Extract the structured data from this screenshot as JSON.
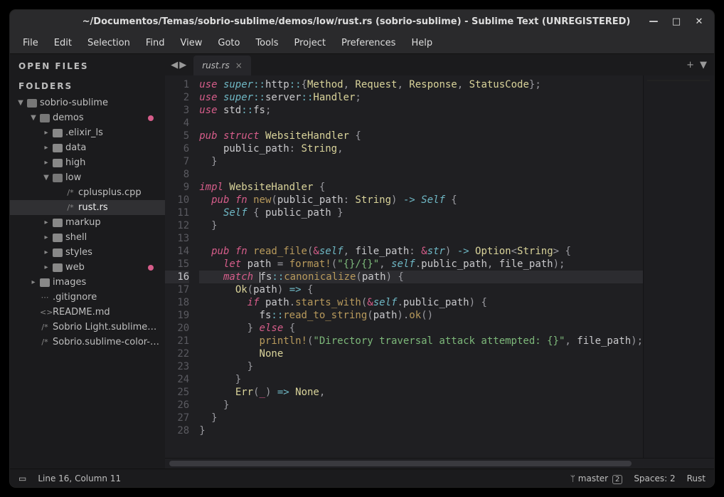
{
  "title": "~/Documentos/Temas/sobrio-sublime/demos/low/rust.rs (sobrio-sublime) - Sublime Text (UNREGISTERED)",
  "menu": [
    "File",
    "Edit",
    "Selection",
    "Find",
    "View",
    "Goto",
    "Tools",
    "Project",
    "Preferences",
    "Help"
  ],
  "sidebar": {
    "open_files": "OPEN FILES",
    "folders": "FOLDERS",
    "tree": [
      {
        "ind": 0,
        "arrow": "▼",
        "icon": "folder-open",
        "label": "sobrio-sublime"
      },
      {
        "ind": 1,
        "arrow": "▼",
        "icon": "folder-open",
        "label": "demos",
        "dot": true
      },
      {
        "ind": 2,
        "arrow": "▸",
        "icon": "folder",
        "label": ".elixir_ls"
      },
      {
        "ind": 2,
        "arrow": "▸",
        "icon": "folder",
        "label": "data"
      },
      {
        "ind": 2,
        "arrow": "▸",
        "icon": "folder",
        "label": "high"
      },
      {
        "ind": 2,
        "arrow": "▼",
        "icon": "folder-open",
        "label": "low"
      },
      {
        "ind": 3,
        "arrow": "",
        "icon": "/*",
        "label": "cplusplus.cpp"
      },
      {
        "ind": 3,
        "arrow": "",
        "icon": "/*",
        "label": "rust.rs",
        "sel": true
      },
      {
        "ind": 2,
        "arrow": "▸",
        "icon": "folder",
        "label": "markup"
      },
      {
        "ind": 2,
        "arrow": "▸",
        "icon": "folder",
        "label": "shell"
      },
      {
        "ind": 2,
        "arrow": "▸",
        "icon": "folder",
        "label": "styles"
      },
      {
        "ind": 2,
        "arrow": "▸",
        "icon": "folder",
        "label": "web",
        "dot": true
      },
      {
        "ind": 1,
        "arrow": "▸",
        "icon": "folder",
        "label": "images"
      },
      {
        "ind": 1,
        "arrow": "",
        "icon": "⋯",
        "label": ".gitignore"
      },
      {
        "ind": 1,
        "arrow": "",
        "icon": "<>",
        "label": "README.md"
      },
      {
        "ind": 1,
        "arrow": "",
        "icon": "/*",
        "label": "Sobrio Light.sublime-col"
      },
      {
        "ind": 1,
        "arrow": "",
        "icon": "/*",
        "label": "Sobrio.sublime-color-sch"
      }
    ]
  },
  "tab": {
    "name": "rust.rs"
  },
  "status": {
    "sel": "Line 16, Column 11",
    "branch": "master",
    "branch_badge": "2",
    "spaces": "Spaces: 2",
    "lang": "Rust"
  },
  "lines": [
    1,
    2,
    3,
    4,
    5,
    6,
    7,
    8,
    9,
    10,
    11,
    12,
    13,
    14,
    15,
    16,
    17,
    18,
    19,
    20,
    21,
    22,
    23,
    24,
    25,
    26,
    27,
    28
  ],
  "currentLine": 16,
  "code": {
    "l1": [
      [
        "kw",
        "use "
      ],
      [
        "mod",
        "super"
      ],
      [
        "op",
        "::"
      ],
      [
        "id",
        "http"
      ],
      [
        "op",
        "::"
      ],
      [
        "pn",
        "{"
      ],
      [
        "ty",
        "Method"
      ],
      [
        "pn",
        ", "
      ],
      [
        "ty",
        "Request"
      ],
      [
        "pn",
        ", "
      ],
      [
        "ty",
        "Response"
      ],
      [
        "pn",
        ", "
      ],
      [
        "ty",
        "StatusCode"
      ],
      [
        "pn",
        "};"
      ]
    ],
    "l2": [
      [
        "kw",
        "use "
      ],
      [
        "mod",
        "super"
      ],
      [
        "op",
        "::"
      ],
      [
        "id",
        "server"
      ],
      [
        "op",
        "::"
      ],
      [
        "ty",
        "Handler"
      ],
      [
        "pn",
        ";"
      ]
    ],
    "l3": [
      [
        "kw",
        "use "
      ],
      [
        "id",
        "std"
      ],
      [
        "op",
        "::"
      ],
      [
        "id",
        "fs"
      ],
      [
        "pn",
        ";"
      ]
    ],
    "l4": [],
    "l5": [
      [
        "kw",
        "pub "
      ],
      [
        "kw",
        "struct "
      ],
      [
        "ty",
        "WebsiteHandler"
      ],
      [
        "pn",
        " {"
      ]
    ],
    "l6": [
      [
        "pn",
        "    "
      ],
      [
        "id",
        "public_path"
      ],
      [
        "pn",
        ": "
      ],
      [
        "ty",
        "String"
      ],
      [
        "pn",
        ","
      ]
    ],
    "l7": [
      [
        "pn",
        "  }"
      ]
    ],
    "l8": [],
    "l9": [
      [
        "kw",
        "impl "
      ],
      [
        "ty",
        "WebsiteHandler"
      ],
      [
        "pn",
        " {"
      ]
    ],
    "l10": [
      [
        "pn",
        "  "
      ],
      [
        "kw",
        "pub "
      ],
      [
        "kw",
        "fn "
      ],
      [
        "fn",
        "new"
      ],
      [
        "pn",
        "("
      ],
      [
        "id",
        "public_path"
      ],
      [
        "pn",
        ": "
      ],
      [
        "ty",
        "String"
      ],
      [
        "pn",
        ") "
      ],
      [
        "op",
        "-> "
      ],
      [
        "slf",
        "Self"
      ],
      [
        "pn",
        " {"
      ]
    ],
    "l11": [
      [
        "pn",
        "    "
      ],
      [
        "slf",
        "Self"
      ],
      [
        "pn",
        " { "
      ],
      [
        "id",
        "public_path"
      ],
      [
        "pn",
        " }"
      ]
    ],
    "l12": [
      [
        "pn",
        "  }"
      ]
    ],
    "l13": [],
    "l14": [
      [
        "pn",
        "  "
      ],
      [
        "kw",
        "pub "
      ],
      [
        "kw",
        "fn "
      ],
      [
        "fn",
        "read_file"
      ],
      [
        "pn",
        "("
      ],
      [
        "kw2",
        "&"
      ],
      [
        "slf",
        "self"
      ],
      [
        "pn",
        ", "
      ],
      [
        "id",
        "file_path"
      ],
      [
        "pn",
        ": "
      ],
      [
        "kw2",
        "&"
      ],
      [
        "mod",
        "str"
      ],
      [
        "pn",
        ") "
      ],
      [
        "op",
        "-> "
      ],
      [
        "ty",
        "Option"
      ],
      [
        "pn",
        "<"
      ],
      [
        "ty",
        "String"
      ],
      [
        "pn",
        "> {"
      ]
    ],
    "l15": [
      [
        "pn",
        "    "
      ],
      [
        "kw",
        "let "
      ],
      [
        "id",
        "path"
      ],
      [
        "pn",
        " = "
      ],
      [
        "mac",
        "format!"
      ],
      [
        "pn",
        "("
      ],
      [
        "str",
        "\"{}/{}\""
      ],
      [
        "pn",
        ", "
      ],
      [
        "slf",
        "self"
      ],
      [
        "pn",
        "."
      ],
      [
        "id",
        "public_path"
      ],
      [
        "pn",
        ", "
      ],
      [
        "id",
        "file_path"
      ],
      [
        "pn",
        ");"
      ]
    ],
    "l16": [
      [
        "pn",
        "    "
      ],
      [
        "kw",
        "match "
      ],
      [
        "caret",
        ""
      ],
      [
        "id",
        "fs"
      ],
      [
        "op",
        "::"
      ],
      [
        "fn",
        "canonicalize"
      ],
      [
        "pn",
        "("
      ],
      [
        "id",
        "path"
      ],
      [
        "pn",
        ") {"
      ]
    ],
    "l17": [
      [
        "pn",
        "      "
      ],
      [
        "ty",
        "Ok"
      ],
      [
        "pn",
        "("
      ],
      [
        "id",
        "path"
      ],
      [
        "pn",
        ") "
      ],
      [
        "op",
        "=> "
      ],
      [
        "pn",
        "{"
      ]
    ],
    "l18": [
      [
        "pn",
        "        "
      ],
      [
        "kw",
        "if "
      ],
      [
        "id",
        "path"
      ],
      [
        "pn",
        "."
      ],
      [
        "fn",
        "starts_with"
      ],
      [
        "pn",
        "("
      ],
      [
        "kw2",
        "&"
      ],
      [
        "slf",
        "self"
      ],
      [
        "pn",
        "."
      ],
      [
        "id",
        "public_path"
      ],
      [
        "pn",
        ") {"
      ]
    ],
    "l19": [
      [
        "pn",
        "          "
      ],
      [
        "id",
        "fs"
      ],
      [
        "op",
        "::"
      ],
      [
        "fn",
        "read_to_string"
      ],
      [
        "pn",
        "("
      ],
      [
        "id",
        "path"
      ],
      [
        "pn",
        ")."
      ],
      [
        "fn",
        "ok"
      ],
      [
        "pn",
        "()"
      ]
    ],
    "l20": [
      [
        "pn",
        "        } "
      ],
      [
        "kw",
        "else "
      ],
      [
        "pn",
        "{"
      ]
    ],
    "l21": [
      [
        "pn",
        "          "
      ],
      [
        "mac",
        "println!"
      ],
      [
        "pn",
        "("
      ],
      [
        "str",
        "\"Directory traversal attack attempted: {}\""
      ],
      [
        "pn",
        ", "
      ],
      [
        "id",
        "file_path"
      ],
      [
        "pn",
        ");"
      ]
    ],
    "l22": [
      [
        "pn",
        "          "
      ],
      [
        "ty",
        "None"
      ]
    ],
    "l23": [
      [
        "pn",
        "        }"
      ]
    ],
    "l24": [
      [
        "pn",
        "      }"
      ]
    ],
    "l25": [
      [
        "pn",
        "      "
      ],
      [
        "ty",
        "Err"
      ],
      [
        "pn",
        "("
      ],
      [
        "kw2",
        "_"
      ],
      [
        "pn",
        ") "
      ],
      [
        "op",
        "=> "
      ],
      [
        "ty",
        "None"
      ],
      [
        "pn",
        ","
      ]
    ],
    "l26": [
      [
        "pn",
        "    }"
      ]
    ],
    "l27": [
      [
        "pn",
        "  }"
      ]
    ],
    "l28": [
      [
        "pn",
        "}"
      ]
    ]
  }
}
